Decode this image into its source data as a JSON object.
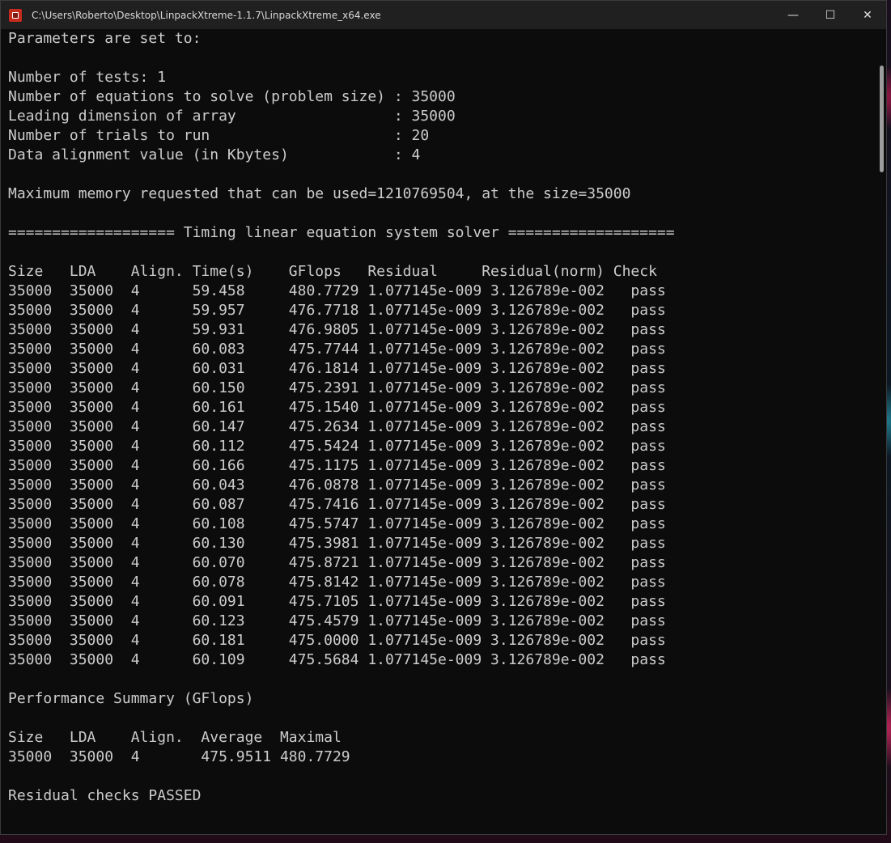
{
  "window": {
    "title": "C:\\Users\\Roberto\\Desktop\\LinpackXtreme-1.1.7\\LinpackXtreme_x64.exe",
    "icon": "console-app-icon",
    "controls": {
      "minimize": "—",
      "maximize": "☐",
      "close": "✕"
    }
  },
  "console": {
    "lines": [
      "Parameters are set to:",
      "",
      "Number of tests: 1",
      "Number of equations to solve (problem size) : 35000",
      "Leading dimension of array                  : 35000",
      "Number of trials to run                     : 20",
      "Data alignment value (in Kbytes)            : 4",
      "",
      "Maximum memory requested that can be used=1210769504, at the size=35000",
      "",
      "=================== Timing linear equation system solver ===================",
      "",
      "Size   LDA    Align. Time(s)    GFlops   Residual     Residual(norm) Check",
      "35000  35000  4      59.458     480.7729 1.077145e-009 3.126789e-002   pass",
      "35000  35000  4      59.957     476.7718 1.077145e-009 3.126789e-002   pass",
      "35000  35000  4      59.931     476.9805 1.077145e-009 3.126789e-002   pass",
      "35000  35000  4      60.083     475.7744 1.077145e-009 3.126789e-002   pass",
      "35000  35000  4      60.031     476.1814 1.077145e-009 3.126789e-002   pass",
      "35000  35000  4      60.150     475.2391 1.077145e-009 3.126789e-002   pass",
      "35000  35000  4      60.161     475.1540 1.077145e-009 3.126789e-002   pass",
      "35000  35000  4      60.147     475.2634 1.077145e-009 3.126789e-002   pass",
      "35000  35000  4      60.112     475.5424 1.077145e-009 3.126789e-002   pass",
      "35000  35000  4      60.166     475.1175 1.077145e-009 3.126789e-002   pass",
      "35000  35000  4      60.043     476.0878 1.077145e-009 3.126789e-002   pass",
      "35000  35000  4      60.087     475.7416 1.077145e-009 3.126789e-002   pass",
      "35000  35000  4      60.108     475.5747 1.077145e-009 3.126789e-002   pass",
      "35000  35000  4      60.130     475.3981 1.077145e-009 3.126789e-002   pass",
      "35000  35000  4      60.070     475.8721 1.077145e-009 3.126789e-002   pass",
      "35000  35000  4      60.078     475.8142 1.077145e-009 3.126789e-002   pass",
      "35000  35000  4      60.091     475.7105 1.077145e-009 3.126789e-002   pass",
      "35000  35000  4      60.123     475.4579 1.077145e-009 3.126789e-002   pass",
      "35000  35000  4      60.181     475.0000 1.077145e-009 3.126789e-002   pass",
      "35000  35000  4      60.109     475.5684 1.077145e-009 3.126789e-002   pass",
      "",
      "Performance Summary (GFlops)",
      "",
      "Size   LDA    Align.  Average  Maximal",
      "35000  35000  4       475.9511 480.7729",
      "",
      "Residual checks PASSED"
    ]
  }
}
